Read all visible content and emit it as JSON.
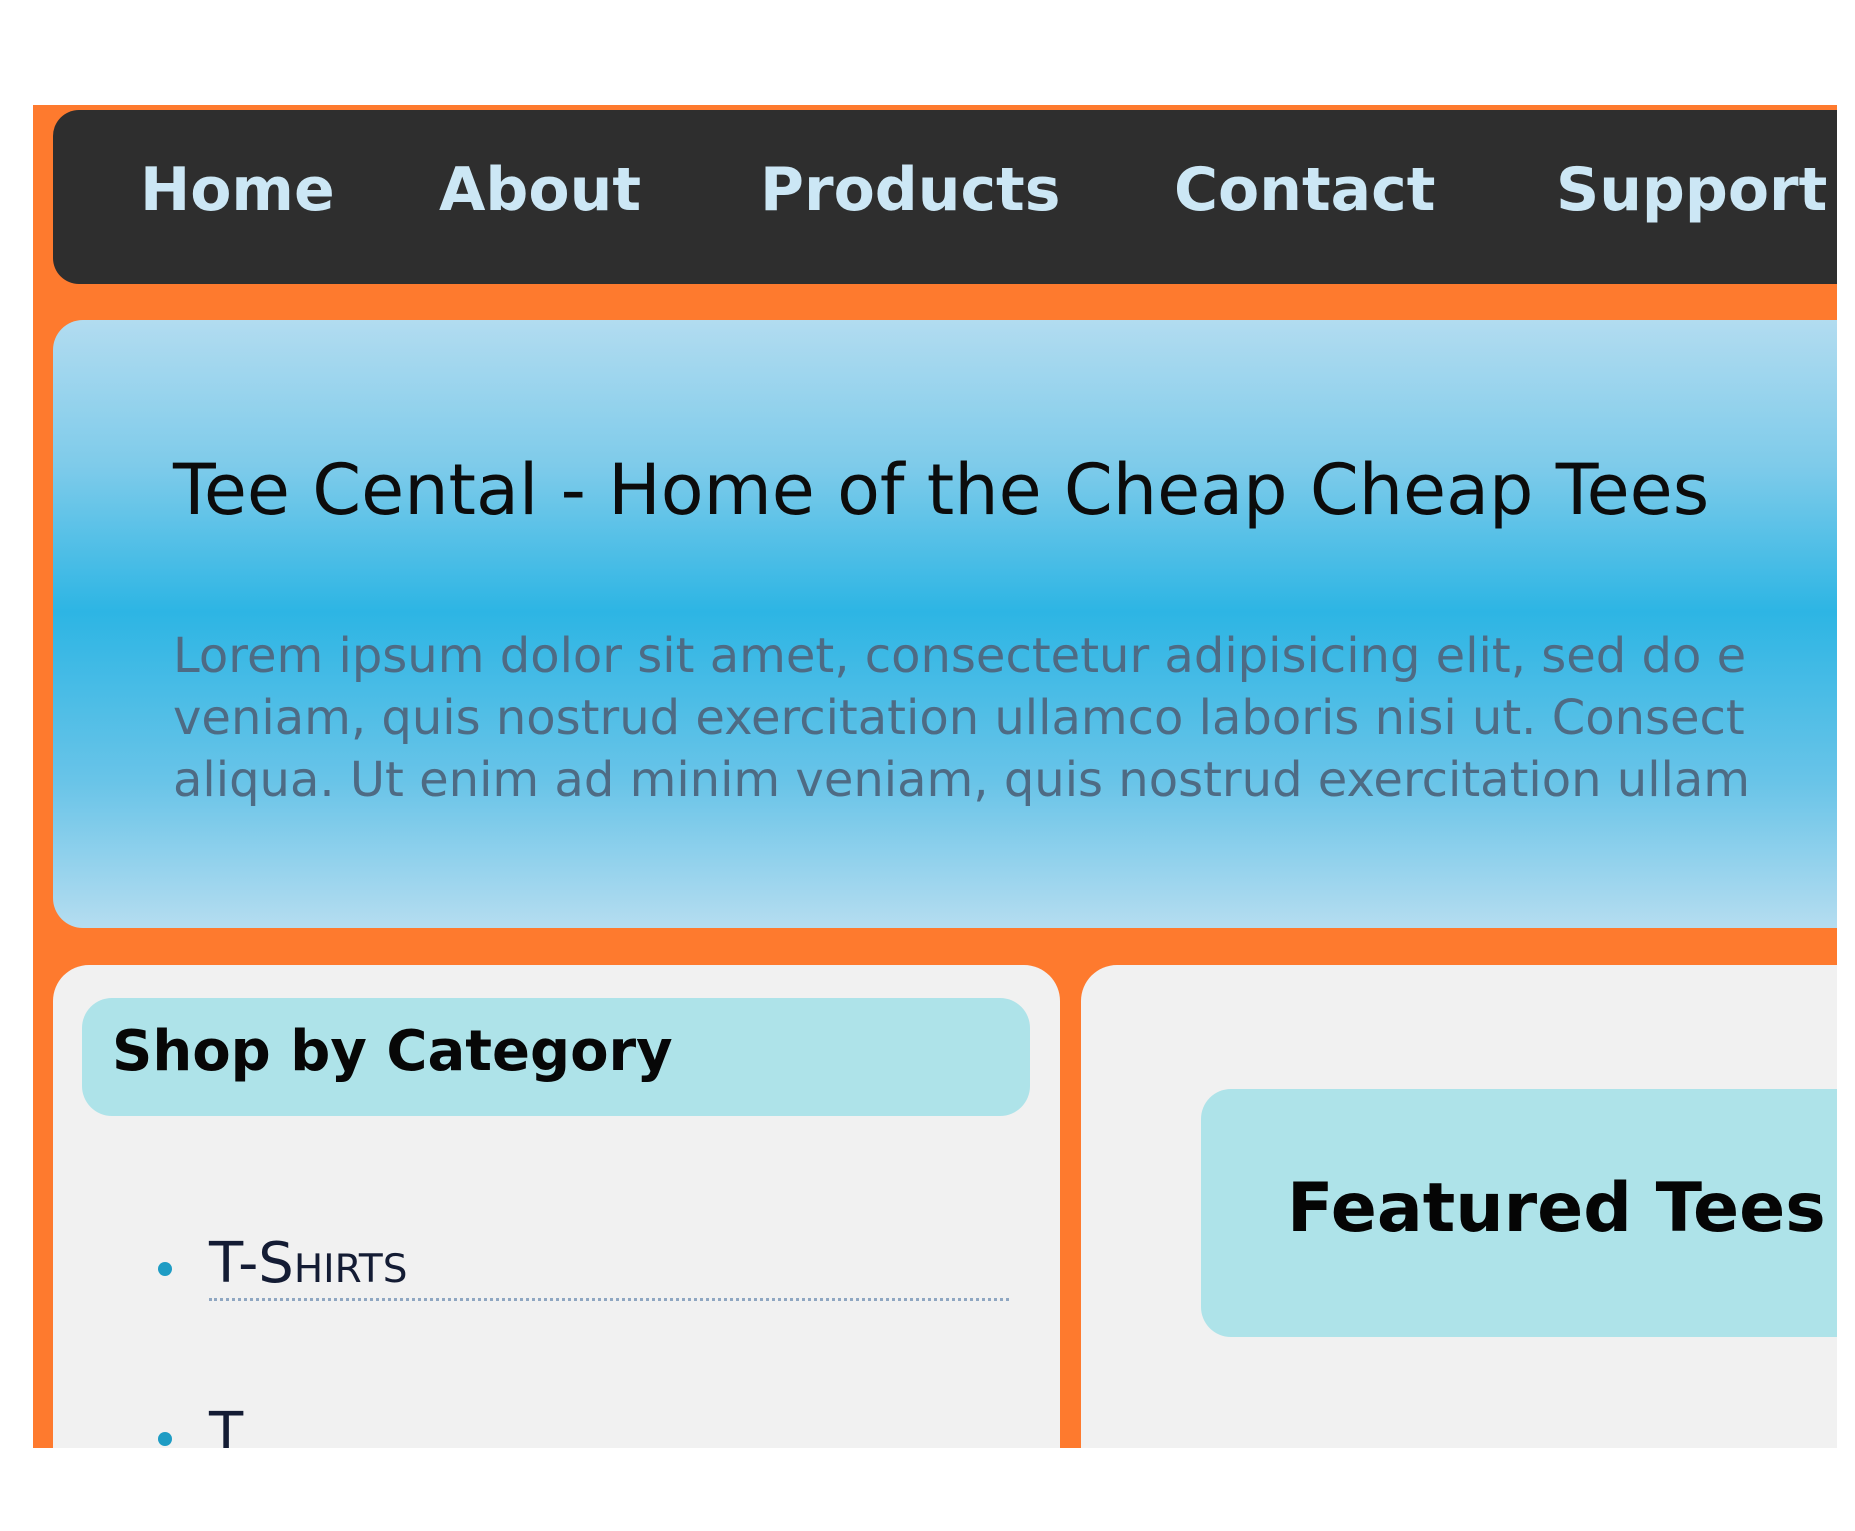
{
  "nav": {
    "items": [
      {
        "label": "Home"
      },
      {
        "label": "About"
      },
      {
        "label": "Products"
      },
      {
        "label": "Contact"
      },
      {
        "label": "Support"
      }
    ]
  },
  "hero": {
    "title": "Tee Cental - Home of the Cheap Cheap Tees",
    "lines": [
      "Lorem ipsum dolor sit amet, consectetur adipisicing elit, sed do e",
      "veniam, quis nostrud exercitation ullamco laboris nisi ut. Consect",
      "aliqua. Ut enim ad minim veniam, quis nostrud exercitation ullam"
    ]
  },
  "sidebar": {
    "heading": "Shop by Category",
    "categories": [
      {
        "label": "T-Shirts"
      },
      {
        "label": "T"
      }
    ]
  },
  "main": {
    "featured_heading": "Featured Tees"
  },
  "colors": {
    "page_background": "#fe7a2e",
    "navbar": "#2e2e2e",
    "nav_text": "#cce7f5",
    "hero_gradient_mid": "#2db5e4",
    "heading_box": "#aee3e9",
    "panel": "#f1f1f1",
    "bullet": "#1e9cc4"
  }
}
